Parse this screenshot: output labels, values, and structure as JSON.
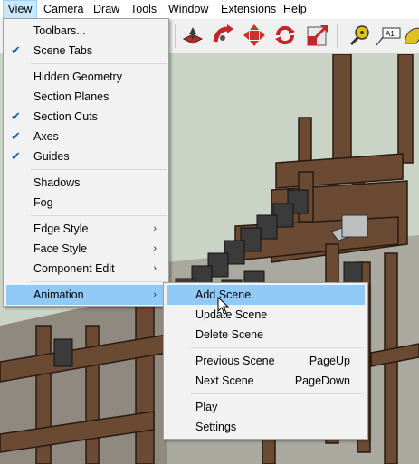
{
  "menubar": {
    "items": [
      "View",
      "Camera",
      "Draw",
      "Tools",
      "Window",
      "Extensions",
      "Help"
    ]
  },
  "toolbar": {
    "icons": [
      "push-pull-icon",
      "follow-me-icon",
      "move-icon",
      "rotate-icon",
      "scale-icon",
      "tape-measure-icon",
      "text-icon",
      "protractor-icon"
    ],
    "text_tool_label": "A1"
  },
  "view_menu": {
    "items": [
      {
        "label": "Toolbars...",
        "checked": false
      },
      {
        "label": "Scene Tabs",
        "checked": true
      },
      {
        "label": "Hidden Geometry",
        "checked": false
      },
      {
        "label": "Section Planes",
        "checked": false
      },
      {
        "label": "Section Cuts",
        "checked": true
      },
      {
        "label": "Axes",
        "checked": true
      },
      {
        "label": "Guides",
        "checked": true
      },
      {
        "label": "Shadows",
        "checked": false
      },
      {
        "label": "Fog",
        "checked": false
      },
      {
        "label": "Edge Style",
        "submenu": true
      },
      {
        "label": "Face Style",
        "submenu": true
      },
      {
        "label": "Component Edit",
        "submenu": true
      },
      {
        "label": "Animation",
        "submenu": true,
        "highlighted": true
      }
    ],
    "check_glyph": "✔",
    "arrow_glyph": "›"
  },
  "animation_submenu": {
    "items": [
      {
        "label": "Add Scene",
        "shortcut": "",
        "highlighted": true
      },
      {
        "label": "Update Scene",
        "shortcut": ""
      },
      {
        "label": "Delete Scene",
        "shortcut": ""
      },
      {
        "label": "Previous Scene",
        "shortcut": "PageUp"
      },
      {
        "label": "Next Scene",
        "shortcut": "PageDown"
      },
      {
        "label": "Play",
        "shortcut": ""
      },
      {
        "label": "Settings",
        "shortcut": ""
      }
    ]
  },
  "colors": {
    "menu_highlight": "#91c9f7",
    "menubar_active": "#cce8ff",
    "sky": "#c9d4c6",
    "wood": "#6b4a33"
  }
}
